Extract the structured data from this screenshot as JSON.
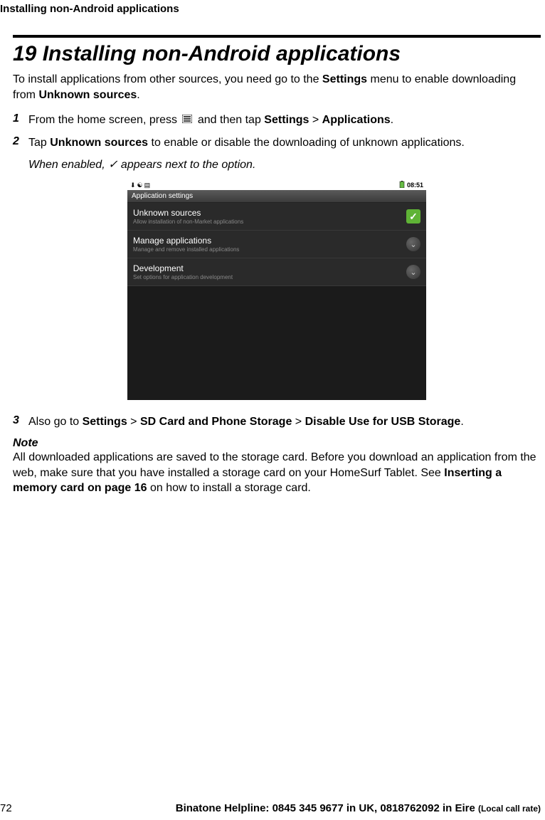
{
  "header": "Installing non-Android applications",
  "chapter_number": "19",
  "chapter_title": "Installing non-Android applications",
  "intro": {
    "pre": "To install applications from other sources, you need go to the ",
    "bold1": "Settings",
    "mid": " menu to enable downloading from ",
    "bold2": "Unknown sources",
    "post": "."
  },
  "steps": [
    {
      "num": "1",
      "parts": {
        "pre": "From the home screen, press ",
        "mid": " and then tap ",
        "b1": "Settings",
        "gt": " > ",
        "b2": "Applications",
        "post": "."
      }
    },
    {
      "num": "2",
      "parts": {
        "pre": "Tap ",
        "b1": "Unknown sources",
        "post": " to enable or disable the downloading of unknown applications."
      },
      "note": {
        "pre": "When enabled, ",
        "check": "✓",
        "post": " appears next to the option."
      }
    },
    {
      "num": "3",
      "parts": {
        "pre": "Also go to ",
        "b1": "Settings",
        "gt1": " > ",
        "b2": "SD Card and Phone Storage",
        "gt2": " > ",
        "b3": "Disable Use for USB Storage",
        "post": "."
      }
    }
  ],
  "screenshot": {
    "status_time": "08:51",
    "app_bar": "Application settings",
    "rows": [
      {
        "title": "Unknown sources",
        "sub": "Allow installation of non-Market applications",
        "control": "check"
      },
      {
        "title": "Manage applications",
        "sub": "Manage and remove installed applications",
        "control": "chevron"
      },
      {
        "title": "Development",
        "sub": "Set options for application development",
        "control": "chevron"
      }
    ]
  },
  "note": {
    "label": "Note",
    "body_pre": "All downloaded applications are saved to the storage card. Before you download an application from the web, make sure that you have installed a storage card on your HomeSurf Tablet. See ",
    "body_bold": "Inserting a memory card on page 16",
    "body_post": " on how to install a storage card."
  },
  "footer": {
    "page": "72",
    "helpline_main": "Binatone Helpline: 0845 345 9677 in UK, 0818762092 in Eire ",
    "helpline_small": "(Local call rate)"
  }
}
